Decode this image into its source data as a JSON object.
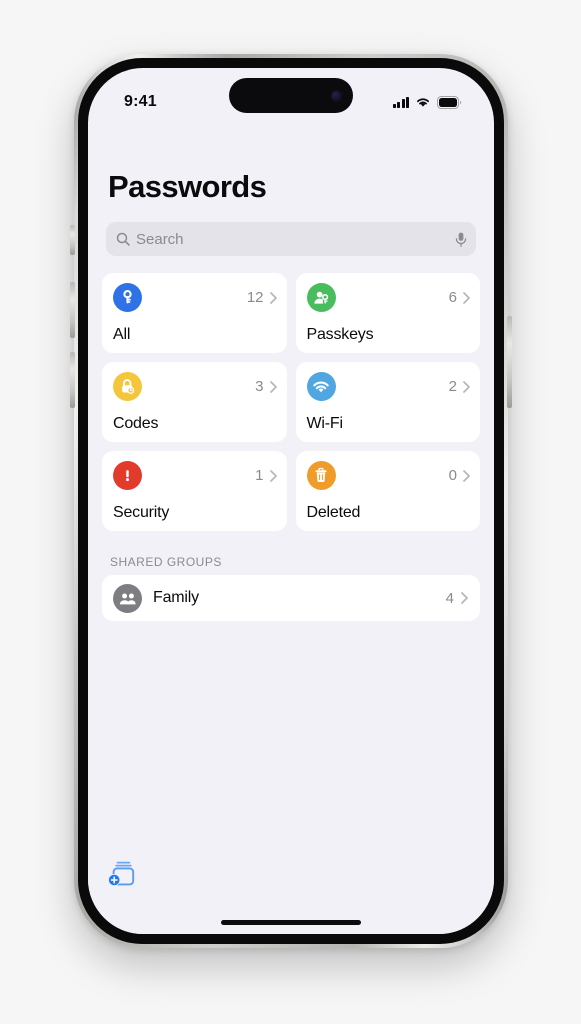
{
  "status_bar": {
    "time": "9:41",
    "cellular_icon": "signal-bars-icon",
    "wifi_icon": "wifi-icon",
    "battery_icon": "battery-full-icon",
    "signal_bars": 4
  },
  "header": {
    "title": "Passwords"
  },
  "search": {
    "placeholder": "Search",
    "value": "",
    "search_icon": "search-icon",
    "mic_icon": "microphone-icon"
  },
  "categories": [
    {
      "id": "all",
      "label": "All",
      "count": "12",
      "icon": "key-icon",
      "color": "#2f72e8"
    },
    {
      "id": "passkeys",
      "label": "Passkeys",
      "count": "6",
      "icon": "person-key-icon",
      "color": "#49bc5e"
    },
    {
      "id": "codes",
      "label": "Codes",
      "count": "3",
      "icon": "lock-clock-icon",
      "color": "#f5c63c"
    },
    {
      "id": "wifi",
      "label": "Wi-Fi",
      "count": "2",
      "icon": "wifi-icon",
      "color": "#50a6e0"
    },
    {
      "id": "security",
      "label": "Security",
      "count": "1",
      "icon": "exclamation-circle-icon",
      "color": "#e23b2b"
    },
    {
      "id": "deleted",
      "label": "Deleted",
      "count": "0",
      "icon": "trash-icon",
      "color": "#ef9c2a"
    }
  ],
  "shared_groups": {
    "header": "SHARED GROUPS",
    "items": [
      {
        "id": "family",
        "name": "Family",
        "count": "4",
        "icon": "people-group-icon",
        "color": "#7e7e82"
      }
    ]
  },
  "toolbar": {
    "add_password_icon": "add-password-icon",
    "accent_color": "#3b7ef0"
  },
  "theme": {
    "page_background": "#f2f1f7",
    "card_background": "#ffffff",
    "secondary_text": "#8a8a8f",
    "primary_text": "#0b0b0d",
    "outer_background": "#f6f6f6"
  }
}
